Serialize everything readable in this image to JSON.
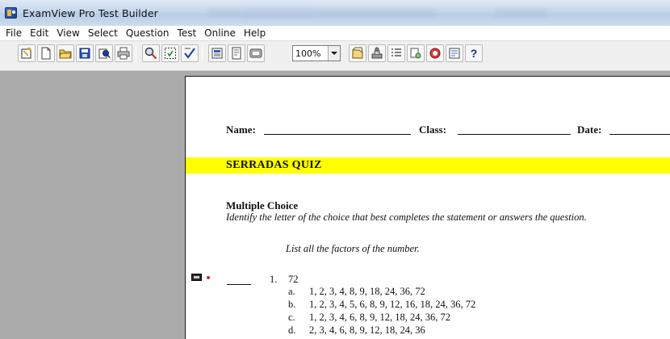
{
  "window": {
    "title": "ExamView Pro Test Builder"
  },
  "menu": [
    "File",
    "Edit",
    "View",
    "Select",
    "Question",
    "Test",
    "Online",
    "Help"
  ],
  "toolbar": {
    "zoom_value": "100%",
    "help_glyph": "?",
    "icons": [
      "wizard-icon",
      "new-icon",
      "open-icon",
      "save-icon",
      "print-preview-icon",
      "print-icon",
      "find-icon",
      "select-icon",
      "check-icon",
      "header-icon",
      "page-setup-icon",
      "layout-icon",
      "question-icon",
      "stamp-icon",
      "list-icon",
      "link-icon",
      "badge-icon",
      "bank-icon",
      "help-icon"
    ]
  },
  "document": {
    "name_label": "Name:",
    "class_label": "Class:",
    "date_label": "Date:",
    "quiz_title": "SERRADAS QUIZ",
    "highlight_color": "#ffff00",
    "section_title": "Multiple Choice",
    "section_instructions": "Identify the letter of the choice that best completes the statement or answers the question.",
    "stem": "List all the factors of the number.",
    "question": {
      "number": "1.",
      "text": "72",
      "options": [
        {
          "letter": "a.",
          "text": "1, 2, 3, 4, 8, 9, 18, 24, 36, 72"
        },
        {
          "letter": "b.",
          "text": "1, 2, 3, 4, 5, 6, 8, 9, 12, 16, 18, 24, 36, 72"
        },
        {
          "letter": "c.",
          "text": "1, 2, 3, 4, 6, 8, 9, 12, 18, 24, 36, 72"
        },
        {
          "letter": "d.",
          "text": "2, 3, 4, 6, 8, 9, 12, 18, 24, 36"
        }
      ]
    }
  }
}
